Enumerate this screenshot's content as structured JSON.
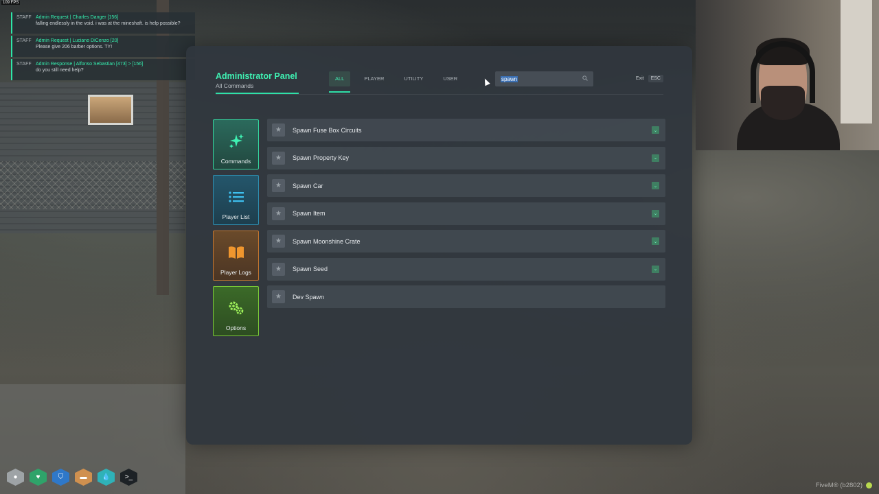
{
  "fps": "109 FPS",
  "chat": [
    {
      "tag": "STAFF",
      "title": "Admin Request | Charles Danger [156]",
      "text": "falling endlessly in the void. i was at the mineshaft. is help possible?"
    },
    {
      "tag": "STAFF",
      "title": "Admin Request | Luciano DiCenzo [20]",
      "text": "Please give 206 barber options. TY!"
    },
    {
      "tag": "STAFF",
      "title": "Admin Response | Alfonso Sebastian [473] > [156]",
      "text": "do you still need help?"
    }
  ],
  "panel": {
    "title": "Administrator Panel",
    "subtitle": "All Commands",
    "tabs": [
      {
        "label": "ALL",
        "active": true
      },
      {
        "label": "PLAYER",
        "active": false
      },
      {
        "label": "UTILITY",
        "active": false
      },
      {
        "label": "USER",
        "active": false
      }
    ],
    "search": {
      "value": "spawn"
    },
    "exit_label": "Exit",
    "esc_label": "ESC"
  },
  "sidenav": [
    {
      "label": "Commands",
      "icon": "commands-sparkle-icon"
    },
    {
      "label": "Player List",
      "icon": "list-icon"
    },
    {
      "label": "Player Logs",
      "icon": "book-icon"
    },
    {
      "label": "Options",
      "icon": "gears-icon"
    }
  ],
  "commands": [
    {
      "label": "Spawn Fuse Box Circuits",
      "expandable": true
    },
    {
      "label": "Spawn Property Key",
      "expandable": true
    },
    {
      "label": "Spawn Car",
      "expandable": true
    },
    {
      "label": "Spawn Item",
      "expandable": true
    },
    {
      "label": "Spawn Moonshine Crate",
      "expandable": true
    },
    {
      "label": "Spawn Seed",
      "expandable": true
    },
    {
      "label": "Dev Spawn",
      "expandable": false
    }
  ],
  "hud": [
    "health-icon",
    "heart-icon",
    "armor-shield-icon",
    "hunger-icon",
    "thirst-drop-icon",
    "console-icon"
  ],
  "watermark": "FiveM® (b2802)",
  "colors": {
    "accent": "#2fe0a8"
  }
}
